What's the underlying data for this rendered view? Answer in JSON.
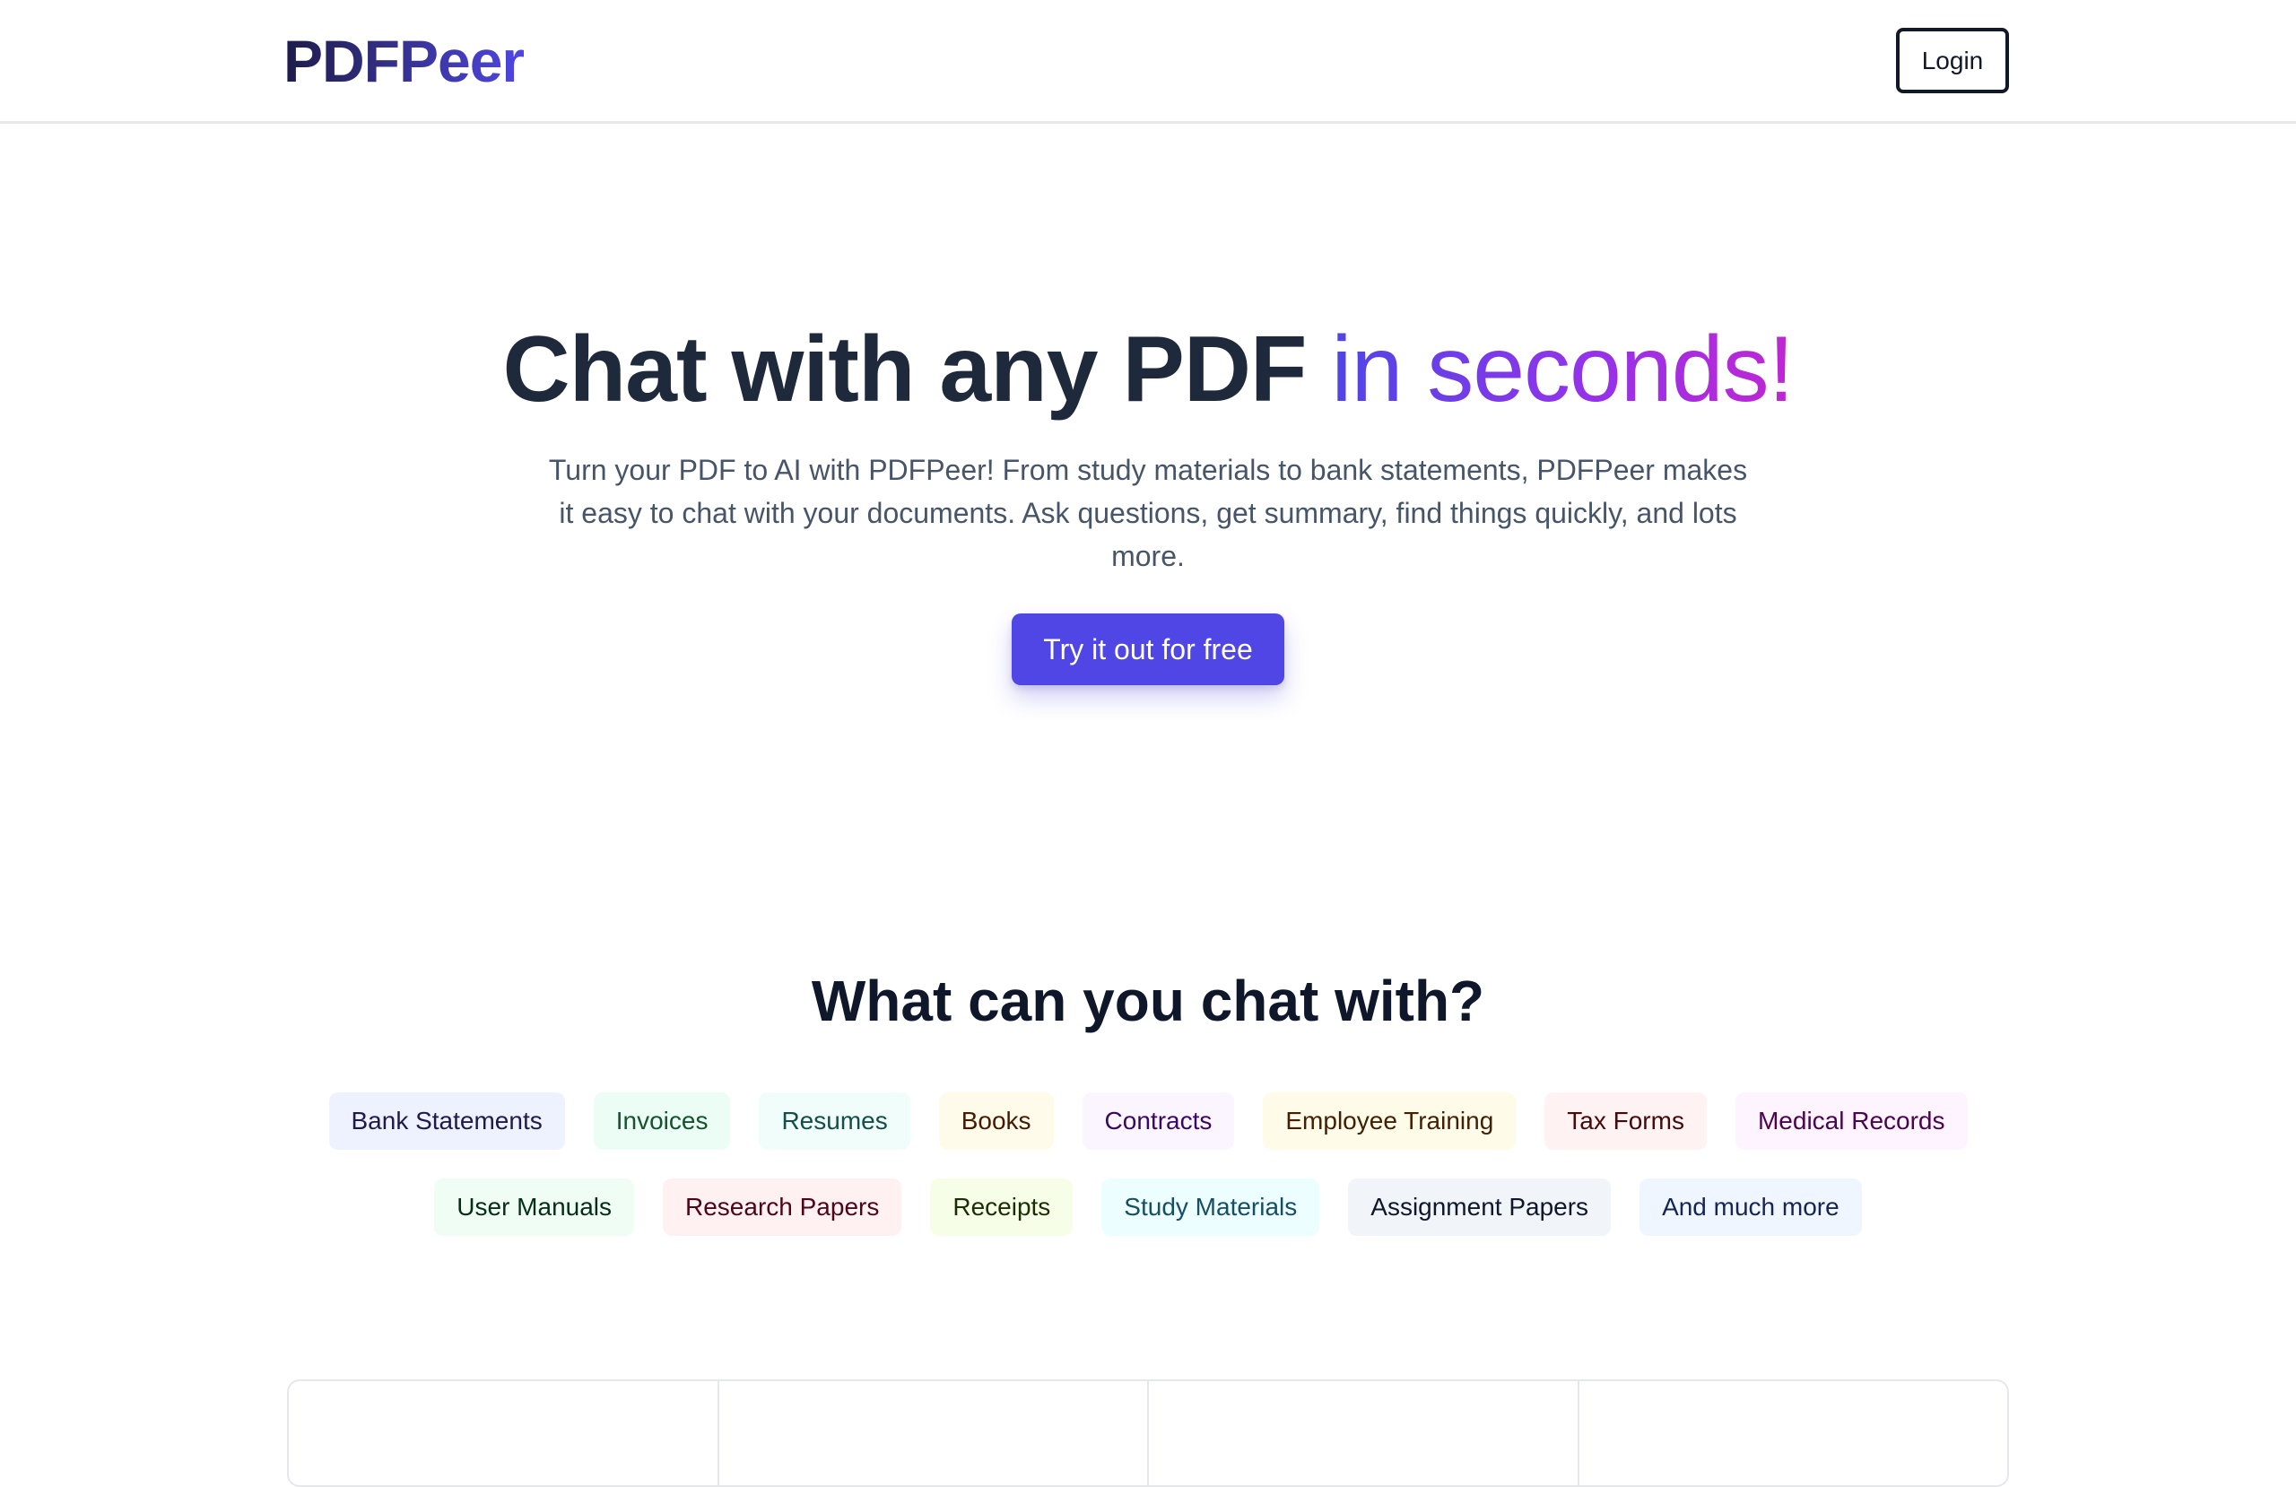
{
  "header": {
    "logo": "PDFPeer",
    "login_label": "Login"
  },
  "hero": {
    "title_main": "Chat with any PDF",
    "title_accent": "in seconds!",
    "subtitle": "Turn your PDF to AI with PDFPeer! From study materials to bank statements, PDFPeer makes it easy to chat with your documents. Ask questions, get summary, find things quickly, and lots more.",
    "cta_label": "Try it out for free"
  },
  "section": {
    "title": "What can you chat with?"
  },
  "tags": [
    {
      "label": "Bank Statements",
      "bg": "#eef2ff",
      "fg": "#1e1b4b"
    },
    {
      "label": "Invoices",
      "bg": "#ecfdf5",
      "fg": "#14532d"
    },
    {
      "label": "Resumes",
      "bg": "#f0fdfa",
      "fg": "#134e4a"
    },
    {
      "label": "Books",
      "bg": "#fffbeb",
      "fg": "#451a03"
    },
    {
      "label": "Contracts",
      "bg": "#faf5ff",
      "fg": "#3b0764"
    },
    {
      "label": "Employee Training",
      "bg": "#fefce8",
      "fg": "#422006"
    },
    {
      "label": "Tax Forms",
      "bg": "#fef2f2",
      "fg": "#450a0a"
    },
    {
      "label": "Medical Records",
      "bg": "#fdf4ff",
      "fg": "#4a044e"
    },
    {
      "label": "User Manuals",
      "bg": "#f0fdf4",
      "fg": "#052e16"
    },
    {
      "label": "Research Papers",
      "bg": "#fff1f2",
      "fg": "#4c0519"
    },
    {
      "label": "Receipts",
      "bg": "#f7fee7",
      "fg": "#1a2e05"
    },
    {
      "label": "Study Materials",
      "bg": "#ecfeff",
      "fg": "#164e63"
    },
    {
      "label": "Assignment Papers",
      "bg": "#f1f5f9",
      "fg": "#0f172a"
    },
    {
      "label": "And much more",
      "bg": "#eff6ff",
      "fg": "#172554"
    }
  ]
}
